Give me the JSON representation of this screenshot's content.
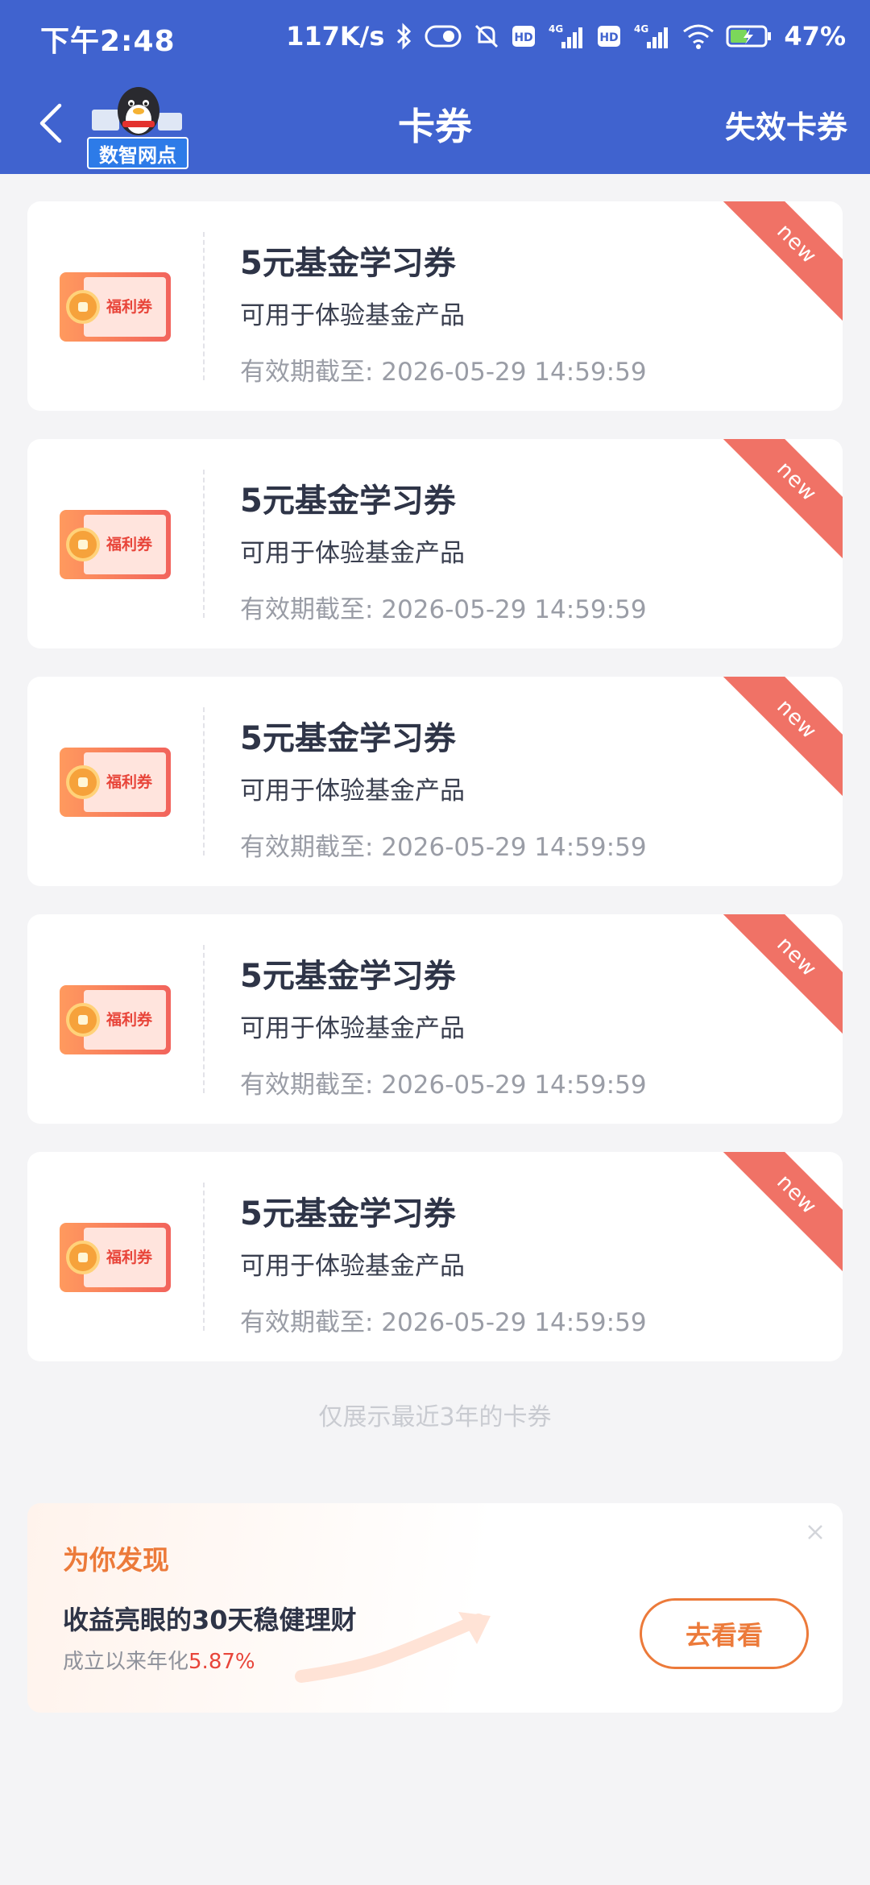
{
  "status_bar": {
    "time": "下午2:48",
    "net_speed": "117K/s",
    "battery_percent": "47%",
    "icons": [
      "bluetooth-icon",
      "toggle-icon",
      "mute-icon",
      "hd-icon",
      "signal-4g-icon",
      "hd-icon",
      "signal-4g-icon",
      "wifi-icon",
      "battery-charging-icon"
    ]
  },
  "nav": {
    "title": "卡券",
    "right_label": "失效卡券",
    "mascot_label": "数智网点",
    "back_icon": "back-arrow-icon"
  },
  "coupons": [
    {
      "thumb_label": "福利券",
      "title": "5元基金学习券",
      "desc": "可用于体验基金产品",
      "expiry": "有效期截至: 2026-05-29 14:59:59",
      "badge": "new"
    },
    {
      "thumb_label": "福利券",
      "title": "5元基金学习券",
      "desc": "可用于体验基金产品",
      "expiry": "有效期截至: 2026-05-29 14:59:59",
      "badge": "new"
    },
    {
      "thumb_label": "福利券",
      "title": "5元基金学习券",
      "desc": "可用于体验基金产品",
      "expiry": "有效期截至: 2026-05-29 14:59:59",
      "badge": "new"
    },
    {
      "thumb_label": "福利券",
      "title": "5元基金学习券",
      "desc": "可用于体验基金产品",
      "expiry": "有效期截至: 2026-05-29 14:59:59",
      "badge": "new"
    },
    {
      "thumb_label": "福利券",
      "title": "5元基金学习券",
      "desc": "可用于体验基金产品",
      "expiry": "有效期截至: 2026-05-29 14:59:59",
      "badge": "new"
    }
  ],
  "list_footer": "仅展示最近3年的卡券",
  "promo": {
    "heading": "为你发现",
    "title": "收益亮眼的30天稳健理财",
    "subtitle_prefix": "成立以来年化",
    "rate": "5.87%",
    "button_label": "去看看"
  },
  "colors": {
    "header_bg": "#4063cf",
    "page_bg": "#f4f4f6",
    "ribbon": "#f07266",
    "accent_orange": "#ec7a3a",
    "rate_red": "#e8453a"
  }
}
